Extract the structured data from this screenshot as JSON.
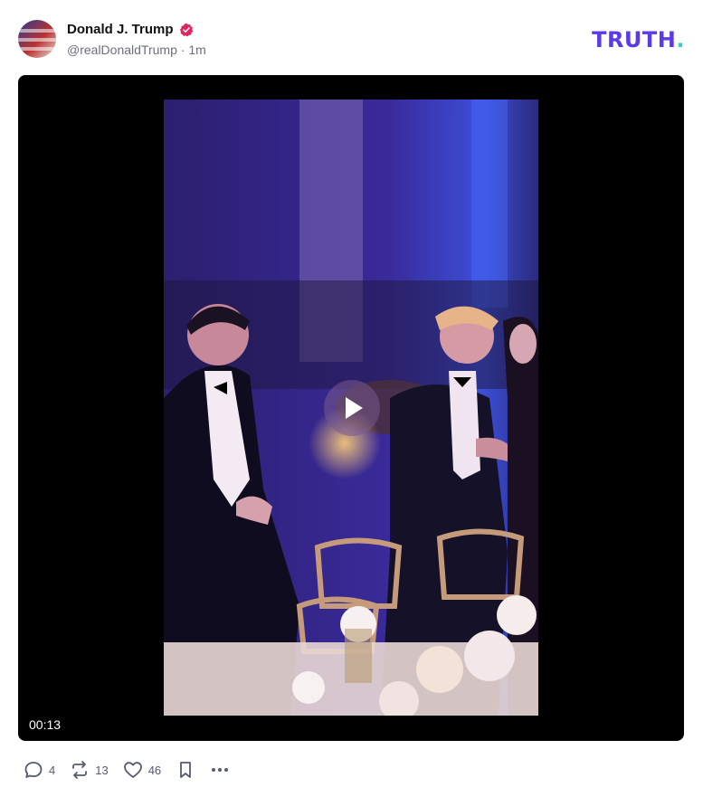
{
  "post": {
    "author": {
      "display_name": "Donald J. Trump",
      "handle": "@realDonaldTrump",
      "time": "1m",
      "verified_icon": "verified-badge-icon"
    },
    "brand": {
      "logo_text": "TRUTH",
      "logo_dot": ".",
      "color": "#5b3be6",
      "dot_color": "#38d5b5"
    },
    "media": {
      "type": "video",
      "duration": "00:13",
      "play_icon": "play-icon"
    },
    "actions": {
      "replies": "4",
      "retruths": "13",
      "likes": "46"
    }
  }
}
